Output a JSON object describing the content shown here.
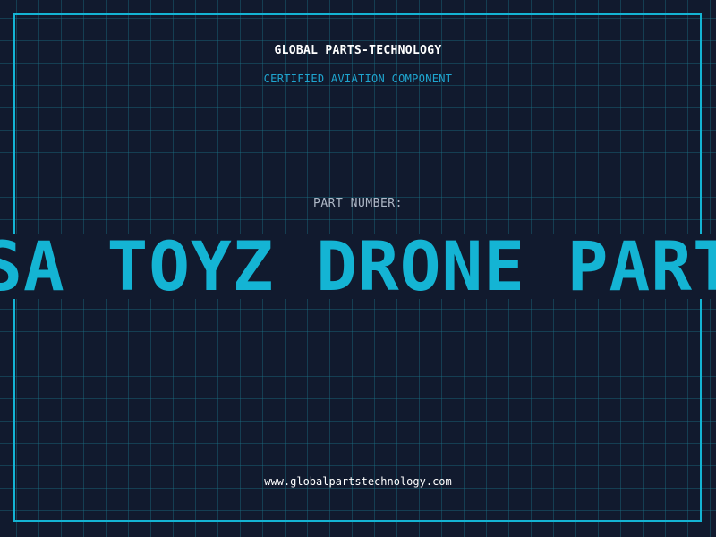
{
  "header": {
    "company": "GLOBAL PARTS-TECHNOLOGY",
    "subtitle": "CERTIFIED AVIATION COMPONENT"
  },
  "part": {
    "label": "PART NUMBER:",
    "value": "USA TOYZ DRONE PARTS"
  },
  "footer": {
    "url": "www.globalpartstechnology.com"
  },
  "colors": {
    "background": "#111a2e",
    "accent": "#14b4d4",
    "grid": "#1a788c"
  }
}
